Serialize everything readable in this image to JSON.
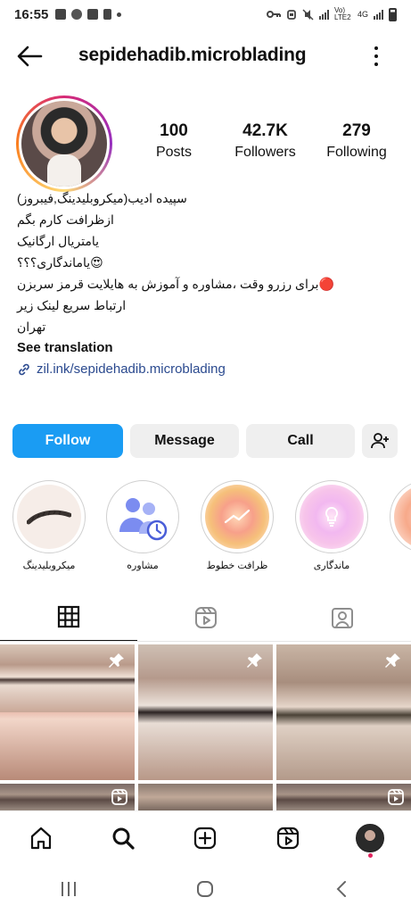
{
  "status_bar": {
    "time": "16:55",
    "network_label": "Vo) LTE2",
    "network_type": "4G"
  },
  "header": {
    "username": "sepidehadib.microblading",
    "back_icon": "arrow-left-icon",
    "menu_icon": "kebab-icon"
  },
  "profile": {
    "stats": [
      {
        "value": "100",
        "label": "Posts"
      },
      {
        "value": "42.7K",
        "label": "Followers"
      },
      {
        "value": "279",
        "label": "Following"
      }
    ],
    "bio_lines": [
      "سپیده ادیب(میکروبلیدینگ,فیبروز)",
      "ازظرافت کارم بگم",
      "یامتریال ارگانیک",
      "😍یاماندگاری؟؟؟",
      "🔴برای رزرو وقت ،مشاوره و آموزش به هایلایت قرمز سربزن",
      "ارتباط سریع لینک زیر",
      "تهران"
    ],
    "see_translation": "See translation",
    "link": "zil.ink/sepidehadib.microblading"
  },
  "actions": {
    "follow": "Follow",
    "message": "Message",
    "call": "Call"
  },
  "highlights": [
    {
      "label": "میکروبلیدینگ"
    },
    {
      "label": "مشاوره"
    },
    {
      "label": "ظرافت خطوط"
    },
    {
      "label": "ماندگاری"
    },
    {
      "label": ""
    }
  ],
  "tabs": [
    "grid-icon",
    "reels-icon",
    "tagged-icon"
  ],
  "nav": [
    "home-icon",
    "search-icon",
    "create-icon",
    "reels-icon",
    "profile-avatar"
  ],
  "colors": {
    "follow_button": "#1a9cf3",
    "link": "#2b4a8f",
    "notification_dot": "#e0245e"
  }
}
